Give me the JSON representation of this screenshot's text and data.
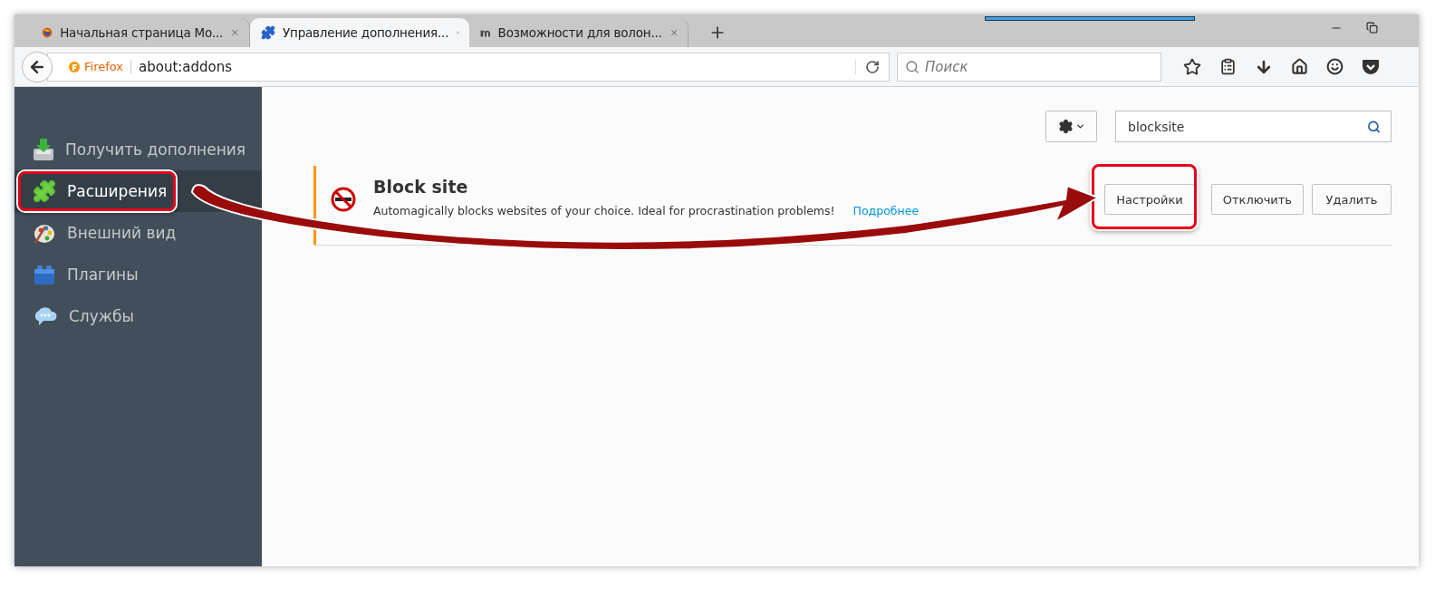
{
  "tabs": [
    {
      "label": "Начальная страница Mo...",
      "selected": false
    },
    {
      "label": "Управление дополнения...",
      "selected": true
    },
    {
      "label": "Возможности для волон...",
      "selected": false
    }
  ],
  "address_bar": {
    "identity": "Firefox",
    "url": "about:addons"
  },
  "search": {
    "placeholder": "Поиск"
  },
  "sidebar": {
    "items": [
      {
        "label": "Получить дополнения",
        "selected": false,
        "highlighted": false
      },
      {
        "label": "Расширения",
        "selected": true,
        "highlighted": true
      },
      {
        "label": "Внешний вид",
        "selected": false,
        "highlighted": false
      },
      {
        "label": "Плагины",
        "selected": false,
        "highlighted": false
      },
      {
        "label": "Службы",
        "selected": false,
        "highlighted": false
      }
    ]
  },
  "addon_search": {
    "value": "blocksite"
  },
  "addon": {
    "name": "Block site",
    "description": "Automagically blocks websites of your choice. Ideal for procrastination problems!",
    "link": "Подробнее",
    "buttons": [
      {
        "label": "Настройки",
        "highlighted": true
      },
      {
        "label": "Отключить",
        "highlighted": false
      },
      {
        "label": "Удалить",
        "highlighted": false
      }
    ]
  }
}
